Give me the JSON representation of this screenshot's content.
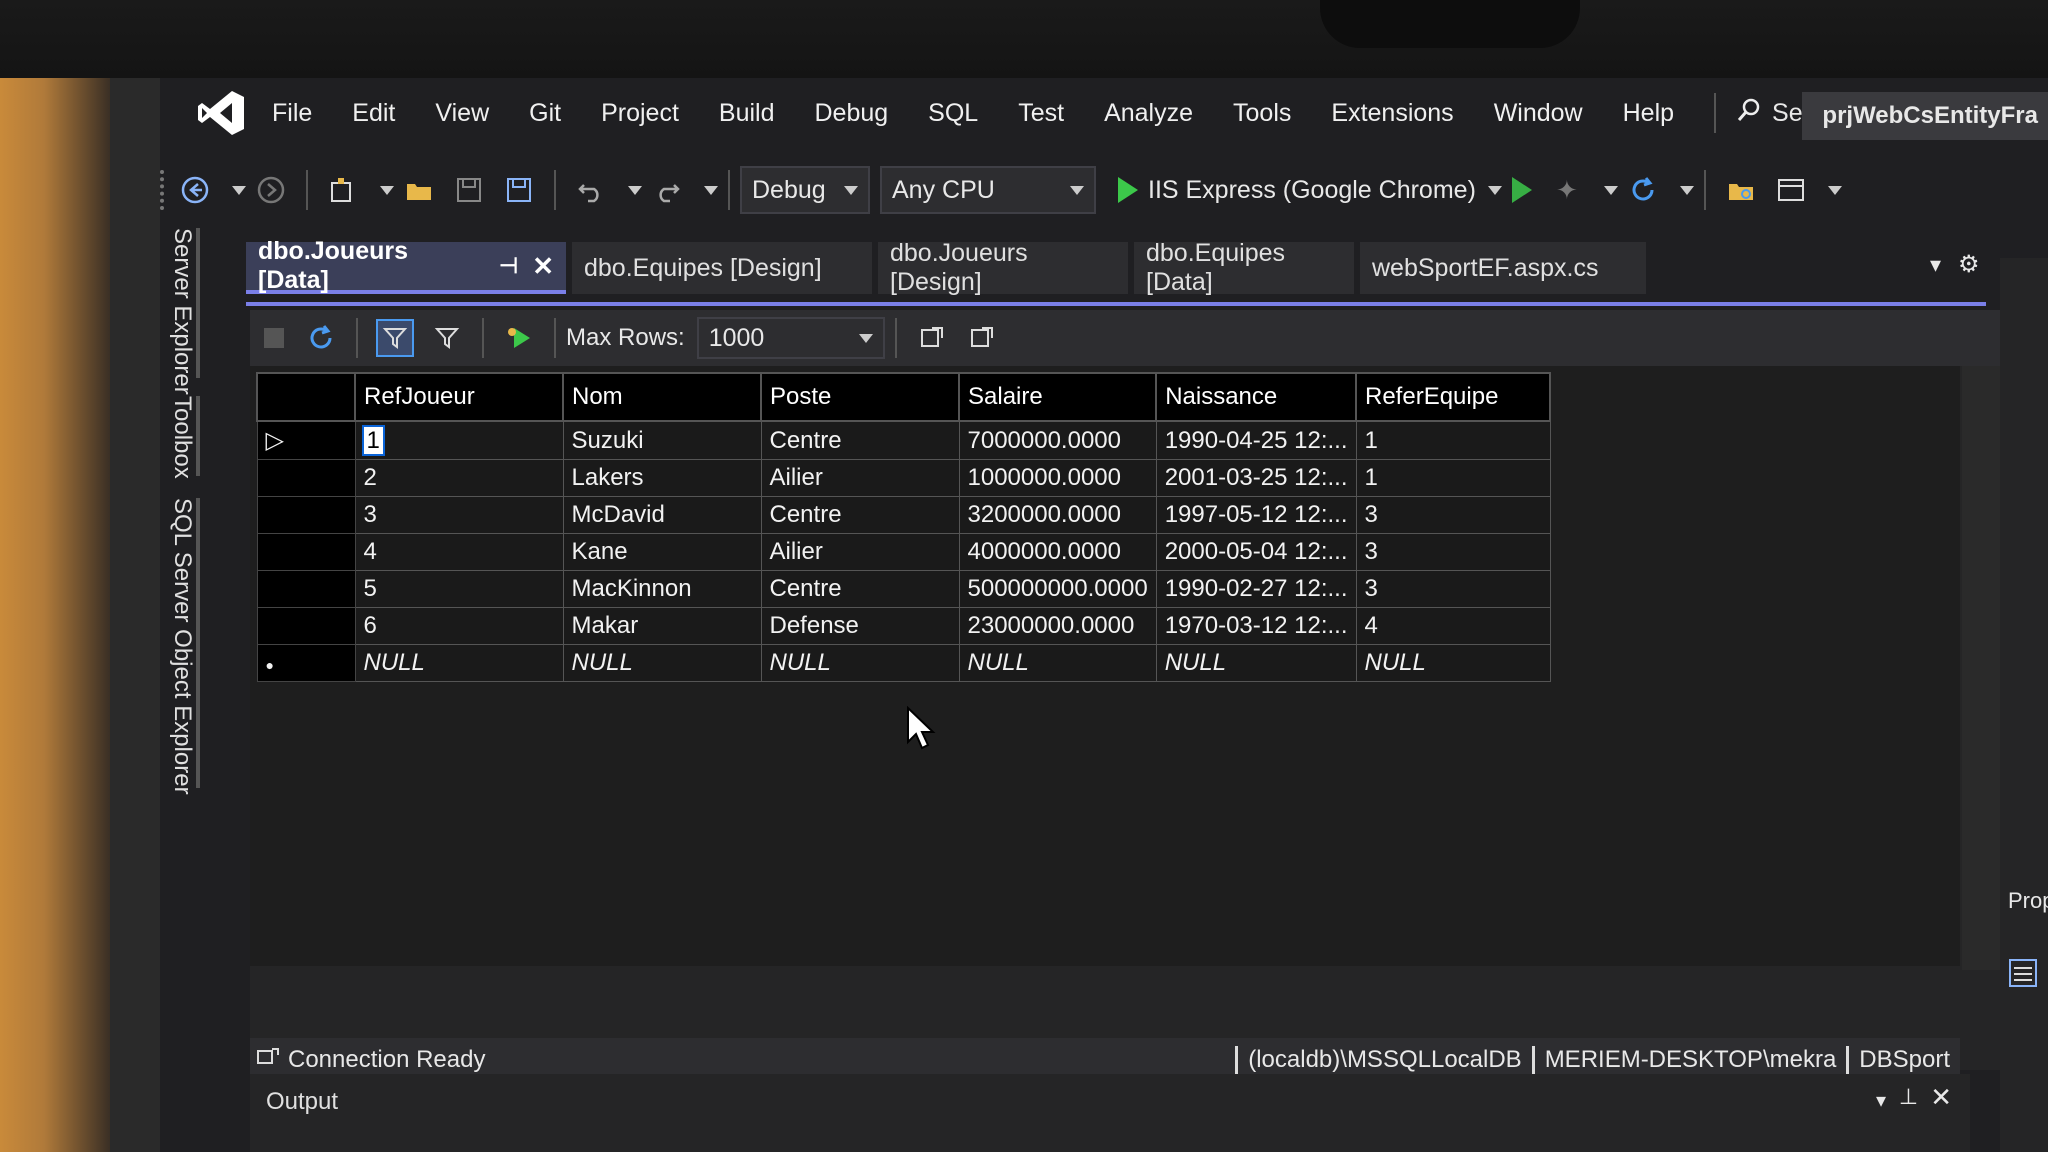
{
  "menubar": {
    "items": [
      "File",
      "Edit",
      "View",
      "Git",
      "Project",
      "Build",
      "Debug",
      "SQL",
      "Test",
      "Analyze",
      "Tools",
      "Extensions",
      "Window",
      "Help"
    ],
    "search_label": "Search",
    "project_title": "prjWebCsEntityFra"
  },
  "toolbar": {
    "config": "Debug",
    "platform": "Any CPU",
    "run_target": "IIS Express (Google Chrome)"
  },
  "side_tabs": [
    "Server Explorer",
    "Toolbox",
    "SQL Server Object Explorer"
  ],
  "doc_tabs": [
    {
      "label": "dbo.Joueurs [Data]",
      "active": true
    },
    {
      "label": "dbo.Equipes [Design]",
      "active": false
    },
    {
      "label": "dbo.Joueurs [Design]",
      "active": false
    },
    {
      "label": "dbo.Equipes [Data]",
      "active": false
    },
    {
      "label": "webSportEF.aspx.cs",
      "active": false
    }
  ],
  "editor_toolbar": {
    "max_rows_label": "Max Rows:",
    "max_rows_value": "1000"
  },
  "grid": {
    "columns": [
      "RefJoueur",
      "Nom",
      "Poste",
      "Salaire",
      "Naissance",
      "ReferEquipe"
    ],
    "rows": [
      [
        "1",
        "Suzuki",
        "Centre",
        "7000000.0000",
        "1990-04-25 12:...",
        "1"
      ],
      [
        "2",
        "Lakers",
        "Ailier",
        "1000000.0000",
        "2001-03-25 12:...",
        "1"
      ],
      [
        "3",
        "McDavid",
        "Centre",
        "3200000.0000",
        "1997-05-12 12:...",
        "3"
      ],
      [
        "4",
        "Kane",
        "Ailier",
        "4000000.0000",
        "2000-05-04 12:...",
        "3"
      ],
      [
        "5",
        "MacKinnon",
        "Centre",
        "500000000.0000",
        "1990-02-27 12:...",
        "3"
      ],
      [
        "6",
        "Makar",
        "Defense",
        "23000000.0000",
        "1970-03-12 12:...",
        "4"
      ]
    ],
    "new_row": [
      "NULL",
      "NULL",
      "NULL",
      "NULL",
      "NULL",
      "NULL"
    ]
  },
  "statusbar": {
    "status": "Connection Ready",
    "server": "(localdb)\\MSSQLLocalDB",
    "user": "MERIEM-DESKTOP\\mekra",
    "database": "DBSport"
  },
  "output": {
    "title": "Output"
  },
  "right_panel": {
    "properties_label": "Prope"
  },
  "colors": {
    "accent": "#7a7fe8",
    "run_green": "#3cc84a",
    "icon_blue": "#8ab4f8"
  }
}
